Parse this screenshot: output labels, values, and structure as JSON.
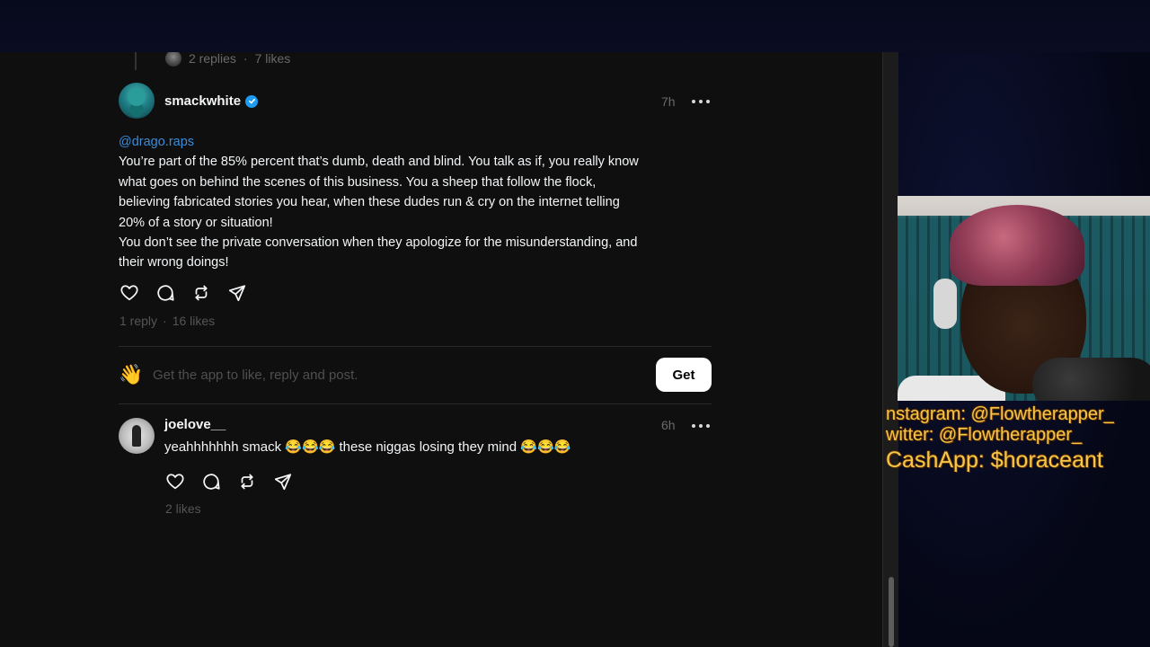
{
  "previous_post": {
    "replies": "2 replies",
    "separator": "·",
    "likes": "7 likes"
  },
  "post": {
    "username": "smackwhite",
    "time": "7h",
    "mention": "@drago.raps",
    "lines": [
      "You’re part of the 85% percent that’s dumb, death and blind. You talk as if, you really know",
      "what goes on behind the scenes of this business. You a sheep that follow the flock,",
      "believing fabricated stories you hear, when these dudes run & cry on the internet telling",
      "20% of a story or situation!",
      "You don’t see the private conversation when they apologize for the misunderstanding, and",
      "their wrong doings!"
    ],
    "replies": "1 reply",
    "separator": "·",
    "likes": "16 likes"
  },
  "get_app": {
    "emoji": "👋",
    "text": "Get the app to like, reply and post.",
    "button": "Get"
  },
  "reply": {
    "username": "joelove__",
    "time": "6h",
    "text_part1": "yeahhhhhhh smack",
    "emoji1": "😂😂😂",
    "text_part2": "these niggas losing they mind",
    "emoji2": "😂😂😂",
    "likes": "2 likes"
  },
  "stream_overlay": {
    "instagram": "nstagram: @Flowtherapper_",
    "twitter": "witter: @Flowtherapper_",
    "cashapp": "CashApp: $horaceant"
  },
  "colors": {
    "background": "#0f0f0f",
    "mention": "#3b8bd9",
    "verified": "#1d9bf0",
    "overlay_text": "#f4c84a"
  },
  "icons": [
    "heart-icon",
    "comment-icon",
    "repost-icon",
    "share-icon",
    "more-icon",
    "verified-icon"
  ]
}
